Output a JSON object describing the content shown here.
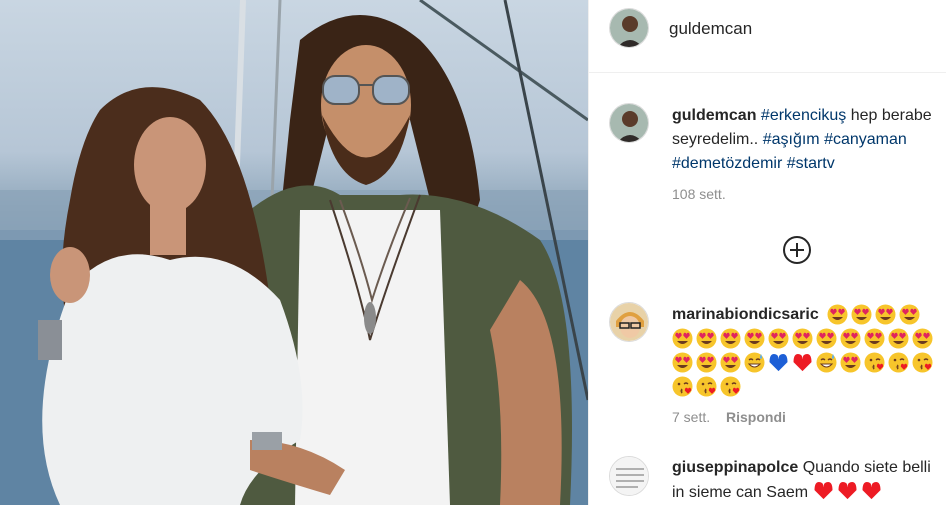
{
  "post": {
    "author": "guldemcan",
    "photo_alt": "Post photo",
    "caption": {
      "username": "guldemcan",
      "line1_tag": "#erkencikuş",
      "line1_text": " hep berabe",
      "line2_text": "seyredelim.. ",
      "line2_tag1": "#aşığım",
      "line2_tag2": "#canyaman",
      "line3_tag1": "#demetözdemir",
      "line3_tag2": "#startv",
      "time": "108 sett."
    },
    "load_more_icon": "plus-circle-icon"
  },
  "comments": [
    {
      "username": "marinabiondicsaric",
      "emoji_rows": [
        [
          "heart-eyes",
          "heart-eyes",
          "heart-eyes",
          "heart-eyes"
        ],
        [
          "heart-eyes",
          "heart-eyes",
          "heart-eyes",
          "heart-eyes",
          "heart-eyes",
          "heart-eyes",
          "heart-eyes",
          "heart-eyes",
          "heart-eyes",
          "heart-eyes",
          "heart-eyes"
        ],
        [
          "heart-eyes",
          "heart-eyes",
          "heart-eyes",
          "grin-sweat",
          "blue-heart",
          "red-heart",
          "grin-sweat",
          "heart-eyes",
          "kiss-heart",
          "kiss-heart",
          "kiss-heart"
        ],
        [
          "kiss-heart",
          "kiss-heart",
          "kiss-heart"
        ]
      ],
      "time": "7 sett.",
      "reply": "Rispondi"
    },
    {
      "username": "giuseppinapolce",
      "text": " Quando siete belli in sieme can Saem ",
      "emoji": [
        "red-heart",
        "red-heart",
        "red-heart"
      ]
    }
  ],
  "colors": {
    "link": "#00376b",
    "muted": "#8e8e8e",
    "text": "#262626",
    "heart": "#ed1b24",
    "blue_heart": "#1d5fd6",
    "emoji_face": "#f7c52b"
  }
}
